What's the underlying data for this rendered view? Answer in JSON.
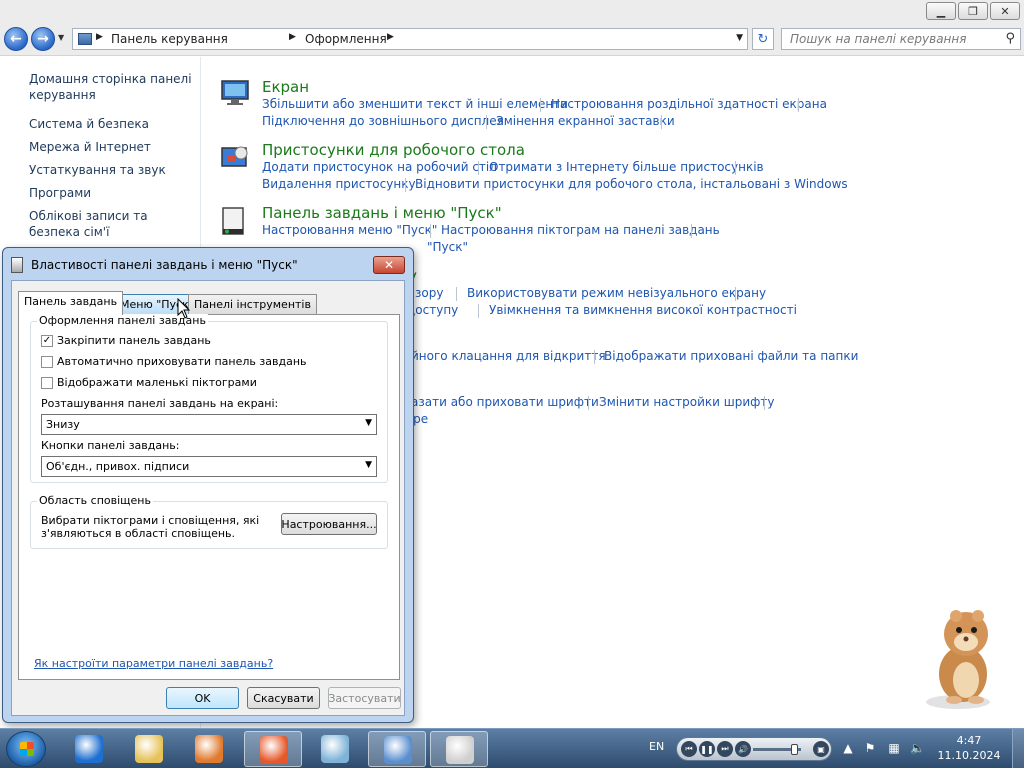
{
  "window": {
    "min_glyph": "▁",
    "max_glyph": "❐",
    "close_glyph": "✕"
  },
  "address": {
    "crumbs": [
      "Панель керування",
      "Оформлення"
    ],
    "search_placeholder": "Пошук на панелі керування"
  },
  "left_nav": {
    "items": [
      "Домашня сторінка панелі керування",
      "Система й безпека",
      "Мережа й Інтернет",
      "Устаткування та звук",
      "Програми",
      "Облікові записи та безпека сім'ї"
    ]
  },
  "content": {
    "categories": [
      {
        "title": "Екран",
        "links": [
          "Збільшити або зменшити текст й інші елементи",
          "Настроювання роздільної здатності екрана",
          "Підключення до зовнішнього дисплея",
          "Змінення екранної заставки"
        ]
      },
      {
        "title": "Пристосунки для робочого стола",
        "links": [
          "Додати пристосунок на робочий стіл",
          "Отримати з Інтернету більше пристосунків",
          "Видалення пристосунку",
          "Відновити пристосунки для робочого стола, інстальовані з Windows"
        ]
      },
      {
        "title": "Панель завдань і меню \"Пуск\"",
        "links": [
          "Настроювання меню \"Пуск\"",
          "Настроювання піктограм на панелі завдань",
          "\"Пуск\""
        ]
      },
      {
        "title": "у",
        "links": [
          "зору",
          "Використовувати режим невізуального екрану",
          "доступу",
          "Увімкнення та вимкнення високої контрастності"
        ]
      },
      {
        "title": "",
        "links": [
          "йного клацання для відкриття",
          "Відображати приховані файли та папки"
        ]
      },
      {
        "title": "",
        "links": [
          "азати або приховати шрифти",
          "Змінити настройки шрифту",
          "вре"
        ]
      }
    ]
  },
  "dialog": {
    "title": "Властивості панелі завдань і меню \"Пуск\"",
    "close_glyph": "✕",
    "tabs": [
      "Панель завдань",
      "Меню \"Пуск\"",
      "Панелі інструментів"
    ],
    "active_tab": 0,
    "appearance": {
      "group_label": "Оформлення панелі завдань",
      "checkboxes": [
        {
          "label": "Закріпити панель завдань",
          "checked": true
        },
        {
          "label": "Автоматично приховувати панель завдань",
          "checked": false
        },
        {
          "label": "Відображати маленькі піктограми",
          "checked": false
        }
      ],
      "location_label": "Розташування панелі завдань на екрані:",
      "location_value": "Знизу",
      "buttons_label": "Кнопки панелі завдань:",
      "buttons_value": "Об'єдн., привох. підписи"
    },
    "notification": {
      "group_label": "Область сповіщень",
      "text": "Вибрати піктограми і сповіщення, які з'являються в області сповіщень.",
      "customize_button": "Настроювання..."
    },
    "help_link": "Як настроїти параметри панелі завдань?",
    "ok_button": "OK",
    "cancel_button": "Скасувати",
    "apply_button": "Застосувати"
  },
  "taskbar": {
    "language": "EN",
    "time": "4:47",
    "date": "11.10.2024",
    "apps": [
      {
        "icon": "internet-explorer-icon",
        "color": "#1e6fd0",
        "active": false
      },
      {
        "icon": "windows-explorer-icon",
        "color": "#e6c35a",
        "active": false
      },
      {
        "icon": "media-player-icon",
        "color": "#e07a2f",
        "active": false
      },
      {
        "icon": "firefox-icon",
        "color": "#e5582a",
        "active": true
      },
      {
        "icon": "window-switcher-icon",
        "color": "#7fb3d8",
        "active": false
      },
      {
        "icon": "control-panel-icon",
        "color": "#5a8fcf",
        "active": true
      },
      {
        "icon": "taskbar-properties-icon",
        "color": "#cfcfcf",
        "active": true
      }
    ]
  }
}
